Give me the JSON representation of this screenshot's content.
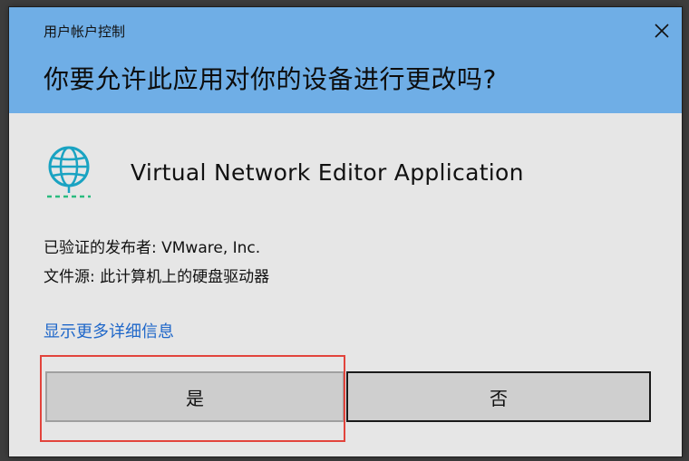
{
  "dialog": {
    "title": "用户帐户控制",
    "question": "你要允许此应用对你的设备进行更改吗?",
    "close_icon": "close-icon",
    "header_color": "#6faee6",
    "body_color": "#e6e6e6"
  },
  "app": {
    "icon": "globe-network-icon",
    "name": "Virtual Network Editor Application",
    "icon_color": "#1aa3c2"
  },
  "info": {
    "publisher_line": "已验证的发布者: VMware, Inc.",
    "source_line": "文件源: 此计算机上的硬盘驱动器"
  },
  "details_link": "显示更多详细信息",
  "buttons": {
    "yes": "是",
    "no": "否"
  },
  "annotation": {
    "highlight_color": "#e2443c"
  }
}
